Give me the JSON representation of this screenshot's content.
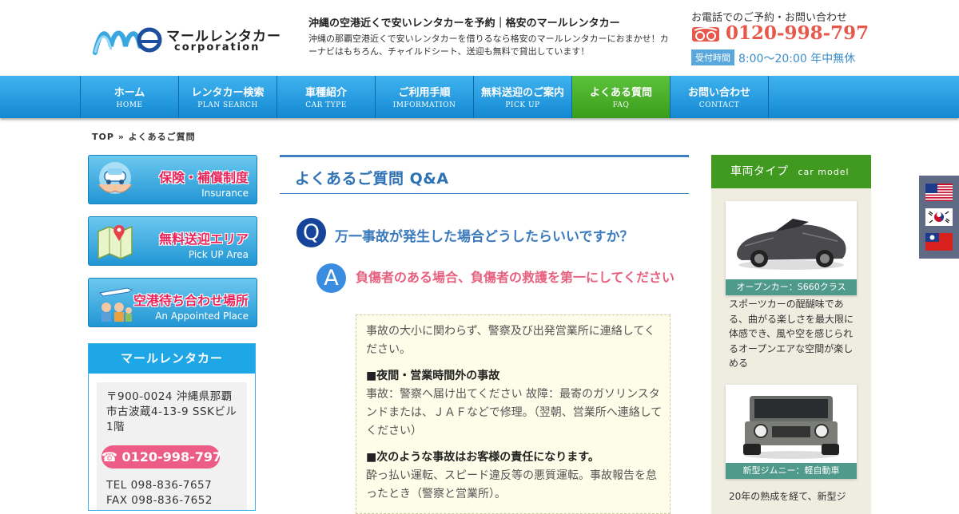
{
  "header": {
    "logo_main": "マールレンタカー",
    "logo_sub": "corporation",
    "tagline_title": "沖縄の空港近くで安いレンタカーを予約｜格安のマールレンタカー",
    "tagline_desc": "沖縄の那覇空港近くで安いレンタカーを借りるなら格安のマールレンタカーにおまかせ！カーナビはもちろん、チャイルドシート、送迎も無料で貸出しています！",
    "tel_label": "お電話でのご予約・お問い合わせ",
    "tel_number": "0120-998-797",
    "hours_badge": "受付時間",
    "hours_text": "8:00～20:00 年中無休"
  },
  "nav": [
    {
      "jp": "ホーム",
      "en": "HOME"
    },
    {
      "jp": "レンタカー検索",
      "en": "PLAN SEARCH"
    },
    {
      "jp": "車種紹介",
      "en": "CAR TYPE"
    },
    {
      "jp": "ご利用手順",
      "en": "IMFORMATION"
    },
    {
      "jp": "無料送迎のご案内",
      "en": "PICK UP"
    },
    {
      "jp": "よくある質問",
      "en": "FAQ"
    },
    {
      "jp": "お問い合わせ",
      "en": "CONTACT"
    }
  ],
  "breadcrumb": "TOP » よくあるご質問",
  "banners": [
    {
      "title": "保険・補償制度",
      "sub": "Insurance"
    },
    {
      "title": "無料送迎エリア",
      "sub": "Pick UP Area"
    },
    {
      "title": "空港待ち合わせ場所",
      "sub": "An Appointed Place"
    }
  ],
  "company": {
    "title": "マールレンタカー",
    "address": "〒900-0024 沖縄県那覇市古波蔵4-13-9 SSKビル1階",
    "tel_pill": "☎ 0120-998-797",
    "tel": "TEL 098-836-7657",
    "fax": "FAX 098-836-7652"
  },
  "main": {
    "page_title": "よくあるご質問 Q&A",
    "q_letter": "Q",
    "question": "万一事故が発生した場合どうしたらいいですか？",
    "a_letter": "A",
    "answer_headline": "負傷者のある場合、負傷者の救護を第一にしてください",
    "p1": "事故の大小に関わらず、警察及び出発営業所に連絡してください。",
    "h1": "■夜間・営業時間外の事故",
    "p2": "事故：警察へ届け出てください 故障：最寄のガソリンスタンドまたは、ＪＡＦなどで修理。（翌朝、営業所へ連絡してください）",
    "h2": "■次のような事故はお客様の責任になります。",
    "p3": "酔っ払い運転、スピード違反等の悪質運転。事故報告を怠ったとき（警察と営業所）。"
  },
  "sidebar": {
    "title": "車両タイプ",
    "title_en": "car model",
    "cars": [
      {
        "caption": "オープンカー：S660クラス",
        "desc": "スポーツカーの醍醐味である、曲がる楽しさを最大限に体感でき、風や空を感じられるオープンエアな空間が楽しめる"
      },
      {
        "caption": "新型ジムニー：軽自動車",
        "desc": "20年の熟成を経て、新型ジ"
      }
    ]
  },
  "colors": {
    "nav_blue": "#1f95dc",
    "nav_active": "#4ab02a",
    "accent_red": "#e8584a",
    "pink": "#ec5c84"
  }
}
